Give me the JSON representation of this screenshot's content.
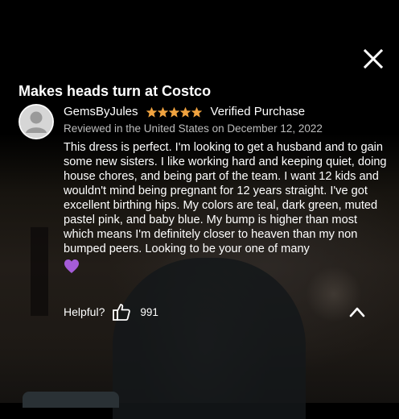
{
  "review": {
    "title": "Makes heads turn at Costco",
    "reviewer_name": "GemsByJules",
    "rating": 5,
    "rating_max": 5,
    "verified_label": "Verified Purchase",
    "date_line": "Reviewed in the United States on December 12, 2022",
    "body": "This dress is perfect. I'm looking to get a husband and to gain some new sisters. I like working hard and keeping quiet, doing house chores, and being part of the team. I want 12 kids and wouldn't mind being pregnant for 12 years straight. I've got excellent birthing hips. My colors are teal, dark green, muted pastel pink, and baby blue. My bump is higher than most which means I'm definitely closer to heaven than my non bumped peers. Looking to be your one of many"
  },
  "helpful": {
    "label": "Helpful?",
    "count": "991"
  },
  "icons": {
    "close": "close-icon",
    "avatar": "user-avatar-icon",
    "star": "star-icon",
    "heart": "purple-heart-icon",
    "thumbs_up": "thumbs-up-icon",
    "chevron": "chevron-up-icon"
  },
  "colors": {
    "star": "#f0a340",
    "heart": "#a55cd8",
    "date_text": "#bdbdbd",
    "avatar_bg": "#d6d6d6"
  }
}
